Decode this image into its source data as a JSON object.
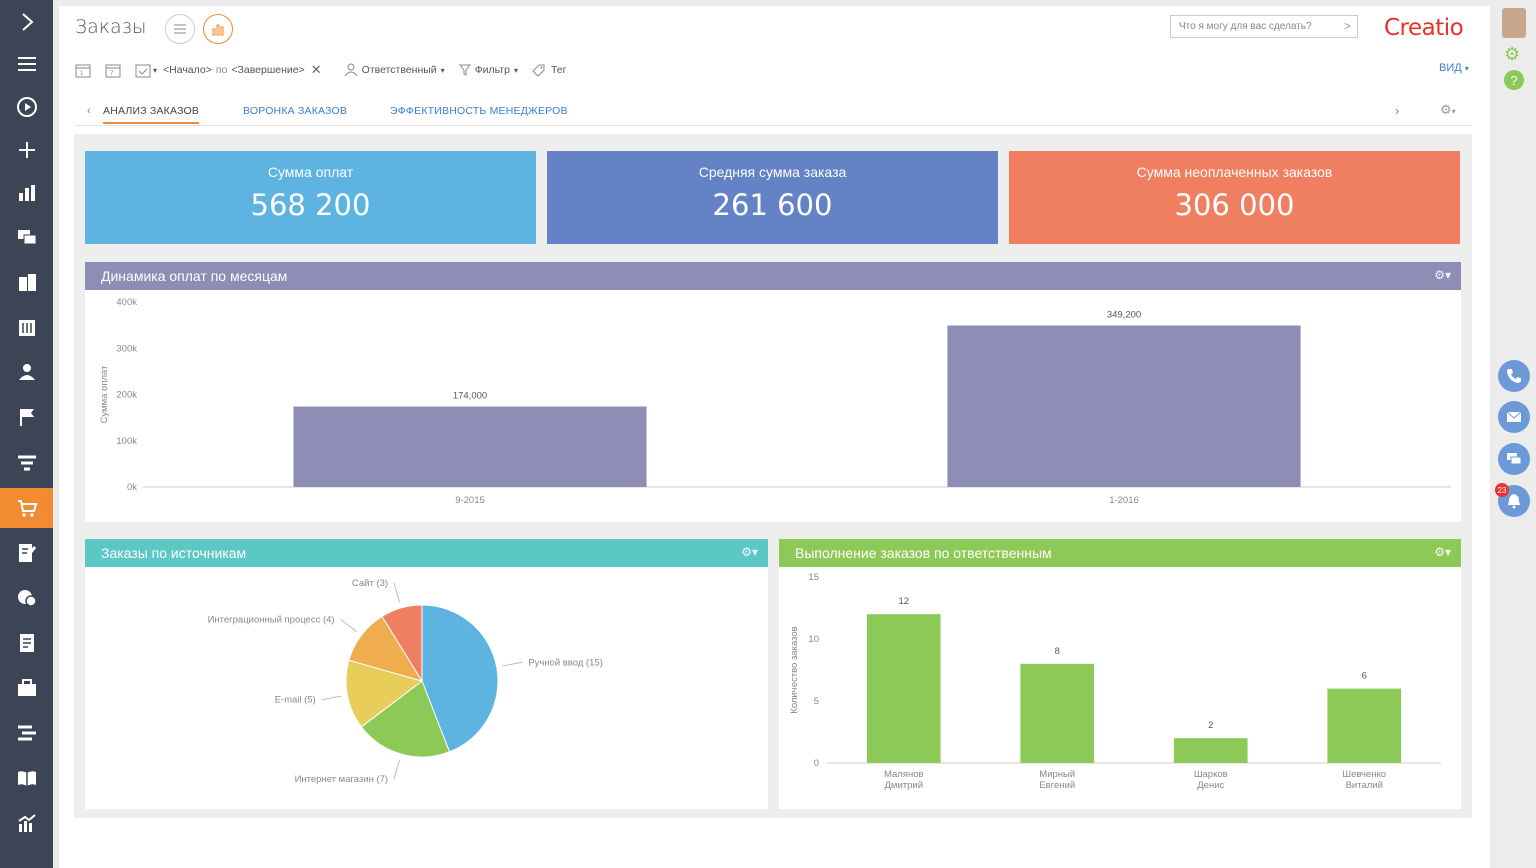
{
  "page": {
    "title": "Заказы"
  },
  "search": {
    "placeholder": "Что я могу для вас сделать?"
  },
  "brand": {
    "logo_text": "Creatio",
    "color": "#e8322c"
  },
  "toolbar": {
    "period_start": "<Начало>",
    "period_sep": "по",
    "period_end": "<Завершение>",
    "owner_label": "Ответственный",
    "filter_label": "Фильтр",
    "tag_label": "Тег",
    "view_label": "ВИД"
  },
  "tabs": [
    {
      "label": "АНАЛИЗ ЗАКАЗОВ",
      "active": true
    },
    {
      "label": "ВОРОНКА ЗАКАЗОВ",
      "active": false
    },
    {
      "label": "ЭФФЕКТИВНОСТЬ МЕНЕДЖЕРОВ",
      "active": false
    }
  ],
  "kpis": [
    {
      "label": "Сумма оплат",
      "value": "568 200",
      "color": "#5eb4e0"
    },
    {
      "label": "Средняя сумма заказа",
      "value": "261 600",
      "color": "#6482c6"
    },
    {
      "label": "Сумма неоплаченных заказов",
      "value": "306 000",
      "color": "#f07e60"
    }
  ],
  "panels": {
    "payments": {
      "title": "Динамика оплат по месяцам",
      "color": "#8e8db5"
    },
    "sources": {
      "title": "Заказы по источникам",
      "color": "#5bc8c5"
    },
    "execution": {
      "title": "Выполнение заказов по ответственным",
      "color": "#8dc956"
    }
  },
  "chart_data": [
    {
      "type": "bar",
      "title": "Динамика оплат по месяцам",
      "categories": [
        "9-2015",
        "1-2016"
      ],
      "values": [
        174000,
        349200
      ],
      "value_labels": [
        "174,000",
        "349,200"
      ],
      "ylabel": "Сумма оплат",
      "ylim": [
        0,
        400000
      ],
      "y_ticks": [
        "0k",
        "100k",
        "200k",
        "300k",
        "400k"
      ],
      "color": "#8e8db5"
    },
    {
      "type": "pie",
      "title": "Заказы по источникам",
      "slices": [
        {
          "label": "Ручной ввод (15)",
          "value": 15,
          "color": "#5eb4e0"
        },
        {
          "label": "Интернет магазин (7)",
          "value": 7,
          "color": "#8dc956"
        },
        {
          "label": "E-mail (5)",
          "value": 5,
          "color": "#e8cd5a"
        },
        {
          "label": "Интеграционный процесс (4)",
          "value": 4,
          "color": "#f0ad4e"
        },
        {
          "label": "Сайт (3)",
          "value": 3,
          "color": "#f07e60"
        }
      ]
    },
    {
      "type": "bar",
      "title": "Выполнение заказов по ответственным",
      "categories": [
        "Малянов Дмитрий",
        "Мирный Евгений",
        "Шарков Денис",
        "Шевченко Виталий"
      ],
      "values": [
        12,
        8,
        2,
        6
      ],
      "ylabel": "Количество заказов",
      "ylim": [
        0,
        15
      ],
      "y_ticks": [
        "0",
        "5",
        "10",
        "15"
      ],
      "color": "#8dc956"
    }
  ],
  "notifications": {
    "count": "23"
  }
}
